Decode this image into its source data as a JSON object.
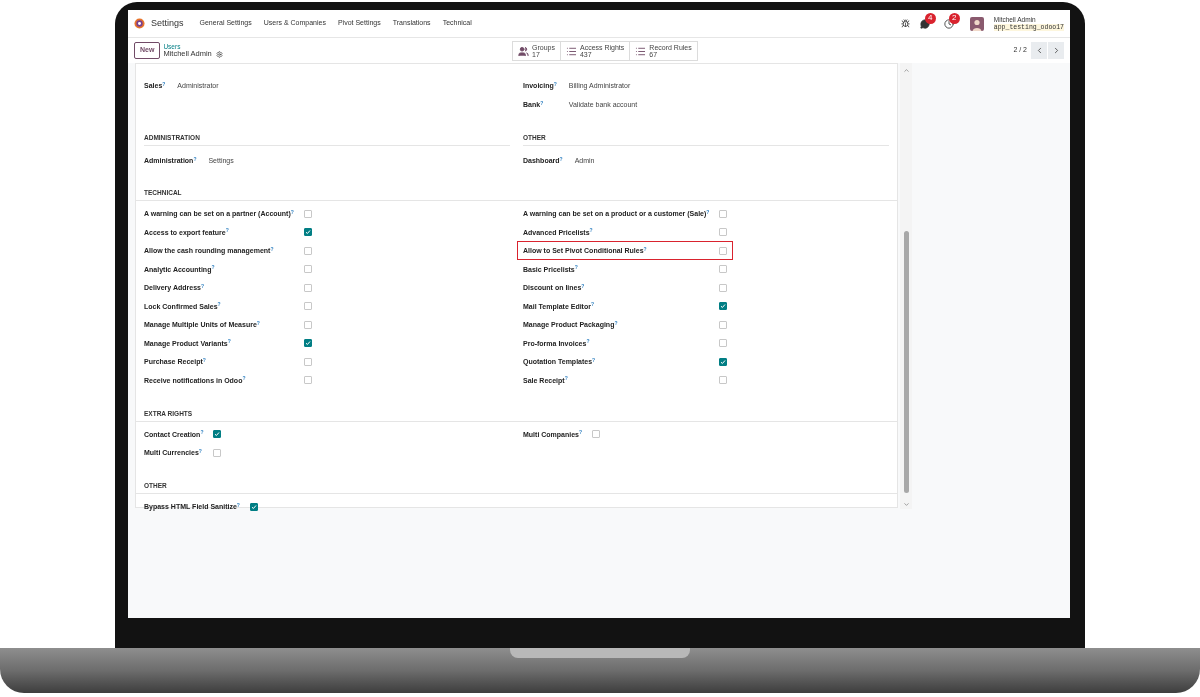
{
  "navbar": {
    "app_name": "Settings",
    "menu": [
      "General Settings",
      "Users & Companies",
      "Pivot Settings",
      "Translations",
      "Technical"
    ],
    "chat_badge": "4",
    "activity_badge": "2",
    "user_name": "Mitchell Admin",
    "database": "app_testing_odoo17"
  },
  "control_panel": {
    "new_button": "New",
    "breadcrumb": "Users",
    "record_title": "Mitchell Admin",
    "pager": "2 / 2",
    "smart_buttons": [
      {
        "kind": "groups",
        "label": "Groups",
        "count": "17"
      },
      {
        "kind": "list",
        "label": "Access Rights",
        "count": "437"
      },
      {
        "kind": "list",
        "label": "Record Rules",
        "count": "67"
      }
    ]
  },
  "blocks": [
    {
      "kind": "fields",
      "columns": [
        [
          {
            "label": "Sales$^{?}$",
            "value": "Administrator"
          }
        ],
        [
          {
            "label": "Invoicing$^{?}$",
            "value": "Billing Administrator"
          },
          {
            "label": "Bank$^{?}$",
            "value": "Validate bank account"
          }
        ]
      ]
    },
    {
      "kind": "field_sections",
      "sections": [
        {
          "title": "ADMINISTRATION",
          "fields": [
            {
              "label": "Administration$^{?}$",
              "value": "Settings"
            }
          ]
        },
        {
          "title": "OTHER",
          "fields": [
            {
              "label": "Dashboard$^{?}$",
              "value": "Admin"
            }
          ]
        }
      ]
    },
    {
      "kind": "checkboxes",
      "title": "TECHNICAL",
      "columns": [
        [
          {
            "label": "A warning can be set on a partner (Account)$^{?}$",
            "checked": false,
            "highlighted": false
          },
          {
            "label": "Access to export feature$^{?}$",
            "checked": true,
            "highlighted": false
          },
          {
            "label": "Allow the cash rounding management$^{?}$",
            "checked": false,
            "highlighted": false
          },
          {
            "label": "Analytic Accounting$^{?}$",
            "checked": false,
            "highlighted": false
          },
          {
            "label": "Delivery Address$^{?}$",
            "checked": false,
            "highlighted": false
          },
          {
            "label": "Lock Confirmed Sales$^{?}$",
            "checked": false,
            "highlighted": false
          },
          {
            "label": "Manage Multiple Units of Measure$^{?}$",
            "checked": false,
            "highlighted": false
          },
          {
            "label": "Manage Product Variants$^{?}$",
            "checked": true,
            "highlighted": false
          },
          {
            "label": "Purchase Receipt$^{?}$",
            "checked": false,
            "highlighted": false
          },
          {
            "label": "Receive notifications in Odoo$^{?}$",
            "checked": false,
            "highlighted": false
          }
        ],
        [
          {
            "label": "A warning can be set on a product or a customer (Sale)$^{?}$",
            "checked": false,
            "highlighted": false
          },
          {
            "label": "Advanced Pricelists$^{?}$",
            "checked": false,
            "highlighted": false
          },
          {
            "label": "Allow to Set Pivot Conditional Rules$^{?}$",
            "checked": false,
            "highlighted": true
          },
          {
            "label": "Basic Pricelists$^{?}$",
            "checked": false,
            "highlighted": false
          },
          {
            "label": "Discount on lines$^{?}$",
            "checked": false,
            "highlighted": false
          },
          {
            "label": "Mail Template Editor$^{?}$",
            "checked": true,
            "highlighted": false
          },
          {
            "label": "Manage Product Packaging$^{?}$",
            "checked": false,
            "highlighted": false
          },
          {
            "label": "Pro-forma Invoices$^{?}$",
            "checked": false,
            "highlighted": false
          },
          {
            "label": "Quotation Templates$^{?}$",
            "checked": true,
            "highlighted": false
          },
          {
            "label": "Sale Receipt$^{?}$",
            "checked": false,
            "highlighted": false
          }
        ]
      ]
    },
    {
      "kind": "checkboxes",
      "title": "EXTRA RIGHTS",
      "columns": [
        [
          {
            "label": "Contact Creation$^{?}$",
            "checked": true,
            "highlighted": false
          },
          {
            "label": "Multi Currencies$^{?}$",
            "checked": false,
            "highlighted": false
          }
        ],
        [
          {
            "label": "Multi Companies$^{?}$",
            "checked": false,
            "highlighted": false
          }
        ]
      ]
    },
    {
      "kind": "checkboxes",
      "title": "OTHER",
      "columns": [
        [
          {
            "label": "Bypass HTML Field Sanitize$^{?}$",
            "checked": true,
            "highlighted": false
          }
        ]
      ]
    }
  ]
}
